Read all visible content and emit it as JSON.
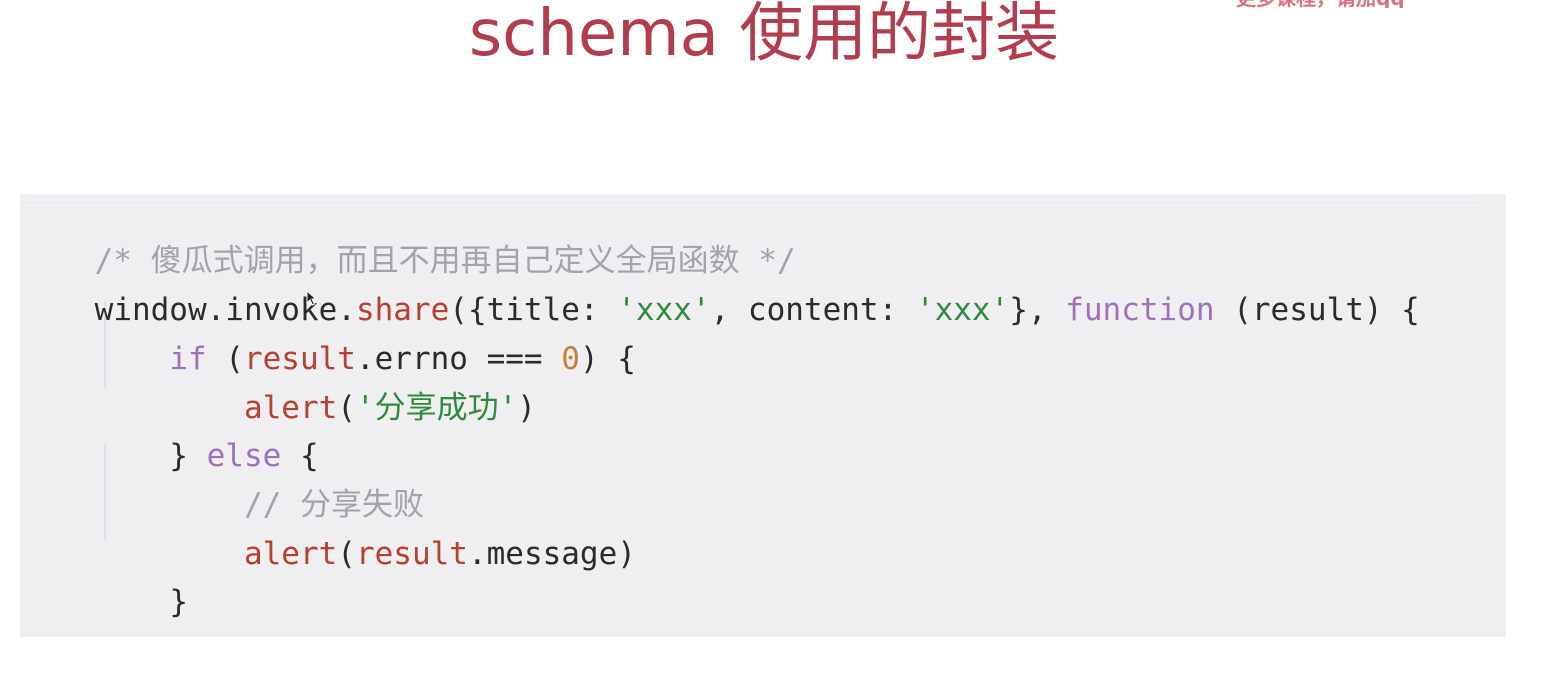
{
  "slide": {
    "title": "schema 使用的封装",
    "corner_watermark": "更多课程，请加qq"
  },
  "code": {
    "line1": {
      "comment": "/* 傻瓜式调用，而且不用再自己定义全局函数 */"
    },
    "line2": {
      "obj": "window.invoke.",
      "method": "share",
      "open": "({title: ",
      "str1": "'xxx'",
      "mid": ", content: ",
      "str2": "'xxx'",
      "close": "}, ",
      "kw": "function",
      "tail": " (result) {"
    },
    "line3": {
      "indent": "    ",
      "kw": "if",
      "open": " (",
      "var": "result",
      "prop": ".errno === ",
      "num": "0",
      "tail": ") {"
    },
    "line4": {
      "indent": "        ",
      "fn": "alert",
      "open": "(",
      "str": "'分享成功'",
      "close": ")"
    },
    "line5": {
      "indent": "    ",
      "open": "} ",
      "kw": "else",
      "tail": " {"
    },
    "line6": {
      "indent": "        ",
      "comment": "// 分享失败"
    },
    "line7": {
      "indent": "        ",
      "fn": "alert",
      "open": "(",
      "var": "result",
      "tail": ".message)"
    },
    "line8": {
      "indent": "    ",
      "text": "}"
    },
    "line9": {
      "text": "})"
    }
  },
  "colors": {
    "title": "#b23d4c",
    "panel_bg": "#efeff1",
    "comment": "#a3a3a8",
    "keyword": "#a071b8",
    "string": "#2f8a3c",
    "variable": "#b8402f",
    "number": "#c8803a"
  }
}
